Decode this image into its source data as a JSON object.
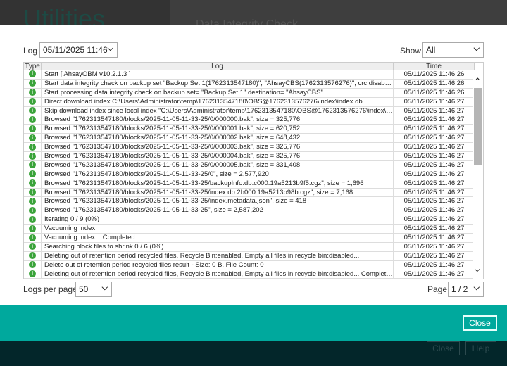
{
  "background": {
    "title": "Utilities",
    "subtitle": "Data Integrity Check",
    "buttons": [
      "Close",
      "Help"
    ]
  },
  "dialog": {
    "log_label": "Log",
    "log_value": "05/11/2025 11:46",
    "show_label": "Show",
    "show_value": "All",
    "columns": [
      "Type",
      "Log",
      "Time"
    ],
    "rows": [
      {
        "log": "Start [ AhsayOBM v10.2.1.3 ]",
        "time": "05/11/2025 11:46:26"
      },
      {
        "log": "Start data integrity check on backup set \"Backup Set 1(1762313547180)\", \"AhsayCBS(1762313576276)\", crc disabled, reb...",
        "time": "05/11/2025 11:46:26"
      },
      {
        "log": "Start processing data integrity check on backup set= \"Backup Set 1\" destination= \"AhsayCBS\"",
        "time": "05/11/2025 11:46:26"
      },
      {
        "log": "Direct download index C:\\Users\\Administrator\\temp\\1762313547180\\OBS@1762313576276\\index\\index.db",
        "time": "05/11/2025 11:46:27"
      },
      {
        "log": "Skip download index since local index \"C:\\Users\\Administrator\\temp\\1762313547180\\OBS@1762313576276\\index\\index....",
        "time": "05/11/2025 11:46:27"
      },
      {
        "log": "Browsed \"1762313547180/blocks/2025-11-05-11-33-25/0/000000.bak\", size = 325,776",
        "time": "05/11/2025 11:46:27"
      },
      {
        "log": "Browsed \"1762313547180/blocks/2025-11-05-11-33-25/0/000001.bak\", size = 620,752",
        "time": "05/11/2025 11:46:27"
      },
      {
        "log": "Browsed \"1762313547180/blocks/2025-11-05-11-33-25/0/000002.bak\", size = 648,432",
        "time": "05/11/2025 11:46:27"
      },
      {
        "log": "Browsed \"1762313547180/blocks/2025-11-05-11-33-25/0/000003.bak\", size = 325,776",
        "time": "05/11/2025 11:46:27"
      },
      {
        "log": "Browsed \"1762313547180/blocks/2025-11-05-11-33-25/0/000004.bak\", size = 325,776",
        "time": "05/11/2025 11:46:27"
      },
      {
        "log": "Browsed \"1762313547180/blocks/2025-11-05-11-33-25/0/000005.bak\", size = 331,408",
        "time": "05/11/2025 11:46:27"
      },
      {
        "log": "Browsed \"1762313547180/blocks/2025-11-05-11-33-25/0\", size = 2,577,920",
        "time": "05/11/2025 11:46:27"
      },
      {
        "log": "Browsed \"1762313547180/blocks/2025-11-05-11-33-25/backupInfo.db.c000.19a5213b9f5.cgz\", size = 1,696",
        "time": "05/11/2025 11:46:27"
      },
      {
        "log": "Browsed \"1762313547180/blocks/2025-11-05-11-33-25/index.db.2b000.19a5213b98b.cgz\", size = 7,168",
        "time": "05/11/2025 11:46:27"
      },
      {
        "log": "Browsed \"1762313547180/blocks/2025-11-05-11-33-25/index.metadata.json\", size = 418",
        "time": "05/11/2025 11:46:27"
      },
      {
        "log": "Browsed \"1762313547180/blocks/2025-11-05-11-33-25\", size = 2,587,202",
        "time": "05/11/2025 11:46:27"
      },
      {
        "log": "Iterating 0 / 9 (0%)",
        "time": "05/11/2025 11:46:27"
      },
      {
        "log": "Vacuuming index",
        "time": "05/11/2025 11:46:27"
      },
      {
        "log": "Vacuuming index... Completed",
        "time": "05/11/2025 11:46:27"
      },
      {
        "log": "Searching block files to shrink 0 / 6 (0%)",
        "time": "05/11/2025 11:46:27"
      },
      {
        "log": "Deleting out of retention period recycled files, Recycle Bin:enabled, Empty all files in recycle bin:disabled...",
        "time": "05/11/2025 11:46:27"
      },
      {
        "log": "Delete out of retention period recycled files result - Size: 0 B, File Count: 0",
        "time": "05/11/2025 11:46:27"
      },
      {
        "log": "Deleting out of retention period recycled files, Recycle Bin:enabled, Empty all files in recycle bin:disabled... Completed",
        "time": "05/11/2025 11:46:27"
      }
    ],
    "logs_per_page_label": "Logs per page",
    "logs_per_page_value": "50",
    "page_label": "Page",
    "page_value": "1 / 2",
    "close_label": "Close"
  },
  "colors": {
    "accent": "#00a99d",
    "info_icon": "#3aa33a"
  },
  "icons": {
    "row_type": "info-icon",
    "dropdown": "chevron-down-icon"
  }
}
